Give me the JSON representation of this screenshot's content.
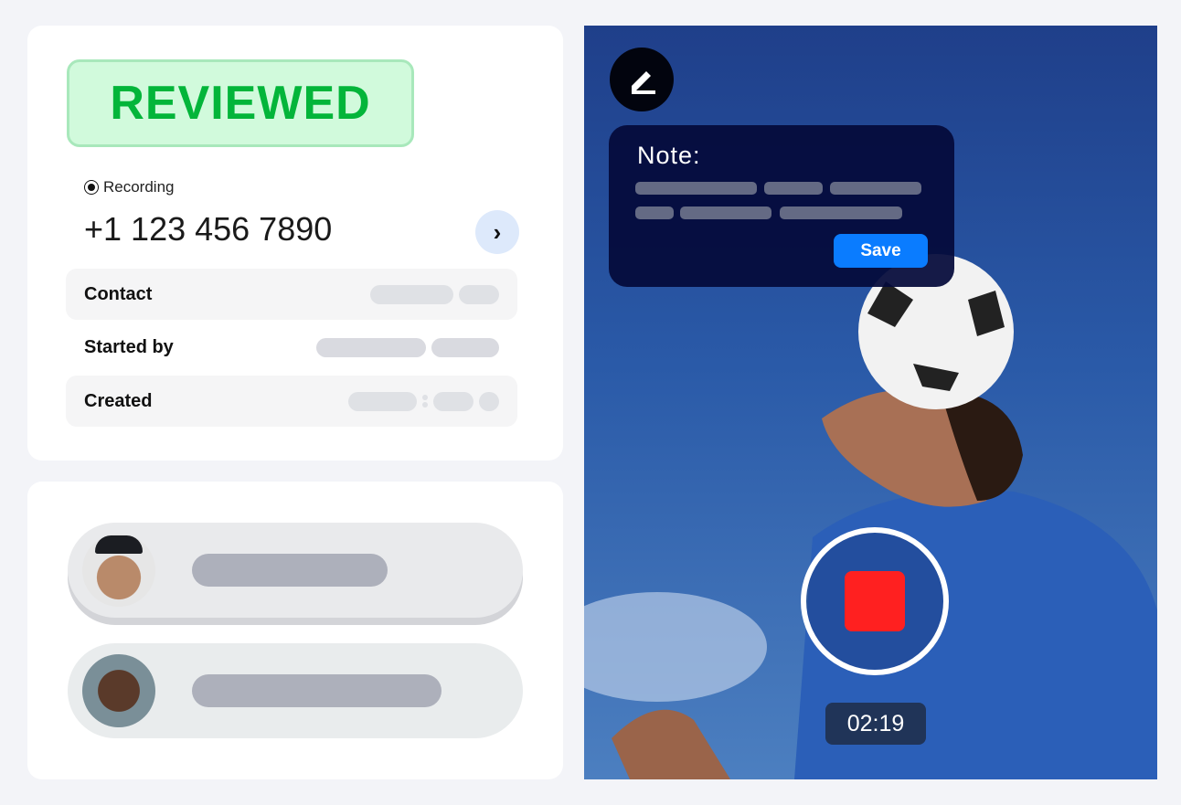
{
  "status_badge": "REVIEWED",
  "recording_label": "Recording",
  "phone_number": "+1 123 456 7890",
  "details": [
    {
      "label": "Contact"
    },
    {
      "label": "Started by"
    },
    {
      "label": "Created"
    }
  ],
  "note": {
    "title": "Note:",
    "save_label": "Save"
  },
  "timer": "02:19",
  "colors": {
    "badge_text": "#03b53a",
    "badge_bg": "#d1fadc",
    "save": "#0a7cff",
    "stop": "#ff2020"
  },
  "icons": [
    "record-radio-icon",
    "chevron-right-icon",
    "pencil-icon",
    "stop-icon"
  ]
}
